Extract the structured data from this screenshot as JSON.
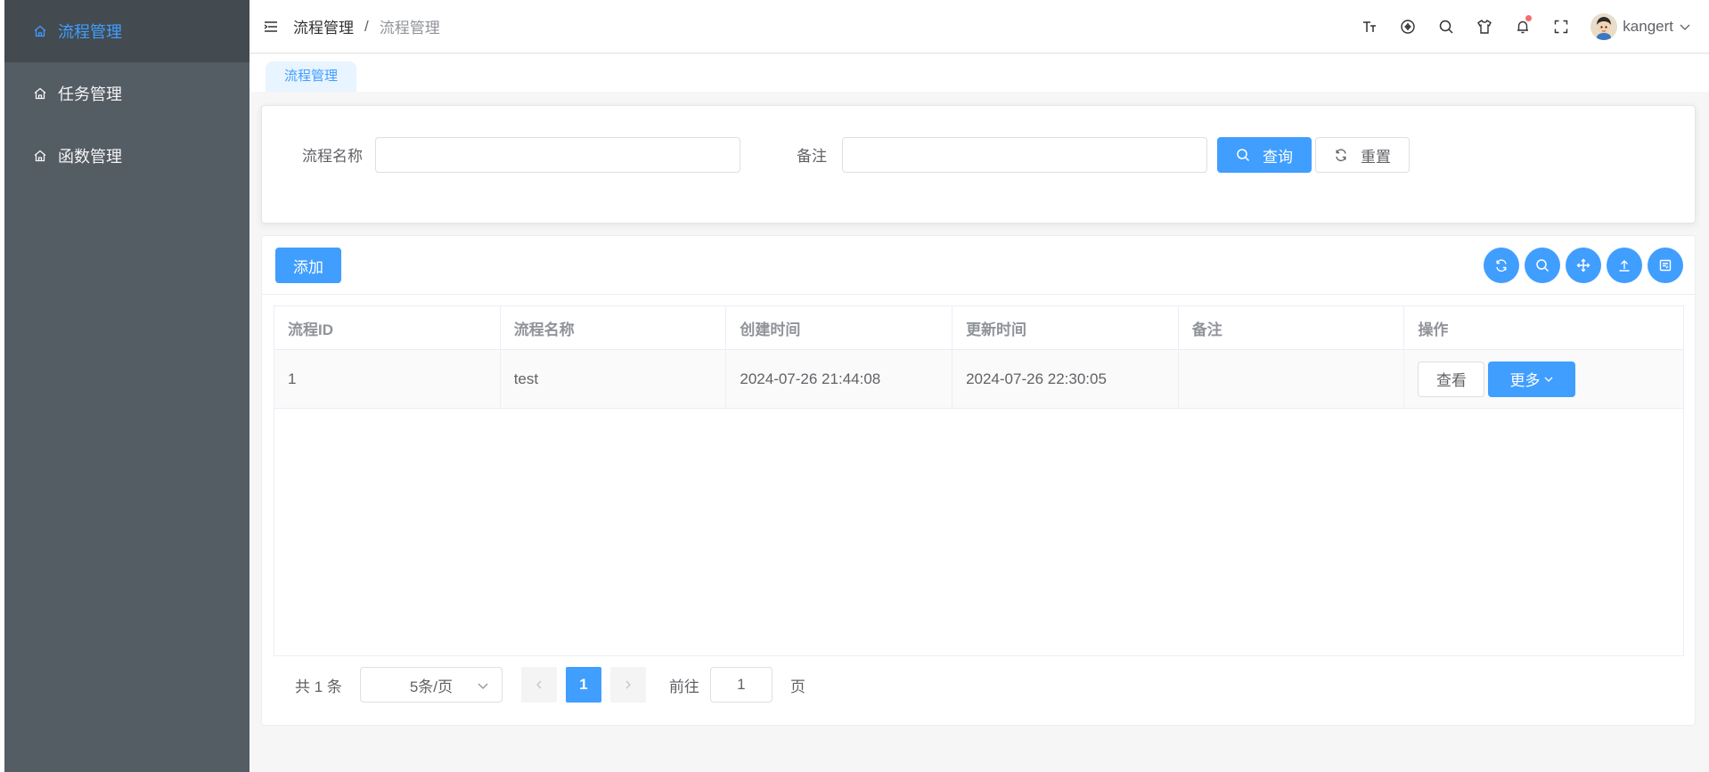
{
  "sidebar": {
    "items": [
      {
        "label": "流程管理",
        "active": true
      },
      {
        "label": "任务管理",
        "active": false
      },
      {
        "label": "函数管理",
        "active": false
      }
    ]
  },
  "header": {
    "breadcrumb": [
      "流程管理",
      "流程管理"
    ],
    "separator": "/",
    "user_name": "kangert",
    "tools": [
      "font-size-icon",
      "github-icon",
      "search-icon",
      "skin-shirt-icon",
      "bell-icon",
      "fullscreen-icon"
    ]
  },
  "tabs": [
    "流程管理"
  ],
  "search": {
    "name_label": "流程名称",
    "name_value": "",
    "remark_label": "备注",
    "remark_value": "",
    "query_label": "查询",
    "reset_label": "重置"
  },
  "table_card": {
    "add_label": "添加",
    "tool_icons": [
      "refresh-icon",
      "search-icon",
      "move-icon",
      "upload-icon",
      "export-icon"
    ]
  },
  "table": {
    "columns": [
      "流程ID",
      "流程名称",
      "创建时间",
      "更新时间",
      "备注",
      "操作"
    ],
    "rows": [
      {
        "id": "1",
        "name": "test",
        "created": "2024-07-26 21:44:08",
        "updated": "2024-07-26 22:30:05",
        "remark": "",
        "view_label": "查看",
        "more_label": "更多"
      }
    ]
  },
  "pagination": {
    "total_text": "共 1 条",
    "page_size": "5条/页",
    "current_page": "1",
    "goto_label": "前往",
    "goto_value": "1",
    "page_suffix": "页"
  },
  "colors": {
    "primary": "#409eff",
    "sidebar_bg": "#545c64",
    "sidebar_active_bg": "#434a50",
    "notification_dot": "#f56c6c"
  }
}
